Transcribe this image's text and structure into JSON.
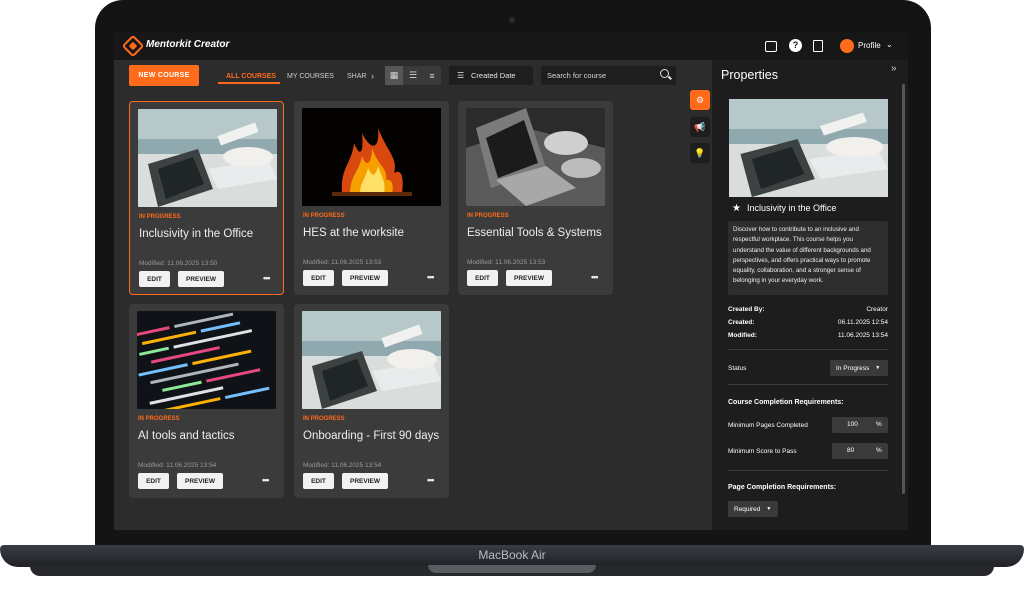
{
  "device": {
    "brand": "MacBook Air"
  },
  "app": {
    "title": "Mentorkit Creator",
    "profile_label": "Profile"
  },
  "toolbar": {
    "new_course_label": "NEW COURSE",
    "tabs": [
      {
        "label": "ALL COURSES",
        "active": true
      },
      {
        "label": "MY COURSES",
        "active": false
      },
      {
        "label": "SHAR",
        "active": false
      }
    ],
    "sort_label": "Created Date",
    "search_placeholder": "Search for course"
  },
  "courses": [
    {
      "status": "IN PROGRESS",
      "title": "Inclusivity in the Office",
      "modified": "Modified: 11.06.2025 13:50",
      "image": "laptop",
      "selected": true
    },
    {
      "status": "IN PROGRESS",
      "title": "HES at the worksite",
      "modified": "Modified: 11.06.2025 13:53",
      "image": "fire",
      "selected": false
    },
    {
      "status": "IN PROGRESS",
      "title": "Essential Tools & Systems",
      "modified": "Modified: 11.06.2025 13:53",
      "image": "bw-laptop",
      "selected": false
    },
    {
      "status": "IN PROGRESS",
      "title": "AI tools and tactics",
      "modified": "Modified: 11.06.2025 13:54",
      "image": "code",
      "selected": false
    },
    {
      "status": "IN PROGRESS",
      "title": "Onboarding - First 90 days",
      "modified": "Modified: 11.06.2025 13:54",
      "image": "laptop",
      "selected": false
    }
  ],
  "card_buttons": {
    "edit": "EDIT",
    "preview": "PREVIEW",
    "more": "•••"
  },
  "properties": {
    "title": "Properties",
    "collapse_icon": "»",
    "course_title": "Inclusivity in the Office",
    "description": "Discover how to contribute to an inclusive and respectful workplace. This course helps you understand the value of different backgrounds and perspectives, and offers practical ways to promote equality, collaboration, and a stronger sense of belonging in your everyday work.",
    "created_by_label": "Created By:",
    "created_by": "Creator",
    "created_label": "Created:",
    "created": "06.11.2025 12:54",
    "modified_label": "Modified:",
    "modified": "11.06.2025 13:54",
    "status_label": "Status",
    "status_value": "In Progress",
    "course_completion_heading": "Course Completion Requirements:",
    "min_pages_label": "Minimum Pages Completed",
    "min_pages_value": "100",
    "min_score_label": "Minimum Score to Pass",
    "min_score_value": "80",
    "percent": "%",
    "page_completion_heading": "Page Completion Requirements:",
    "page_requirement_value": "Required"
  },
  "colors": {
    "accent": "#ff6b1a",
    "background": "#2c2c2c",
    "panel": "#1d1d1d",
    "card": "#3b3b3b"
  }
}
